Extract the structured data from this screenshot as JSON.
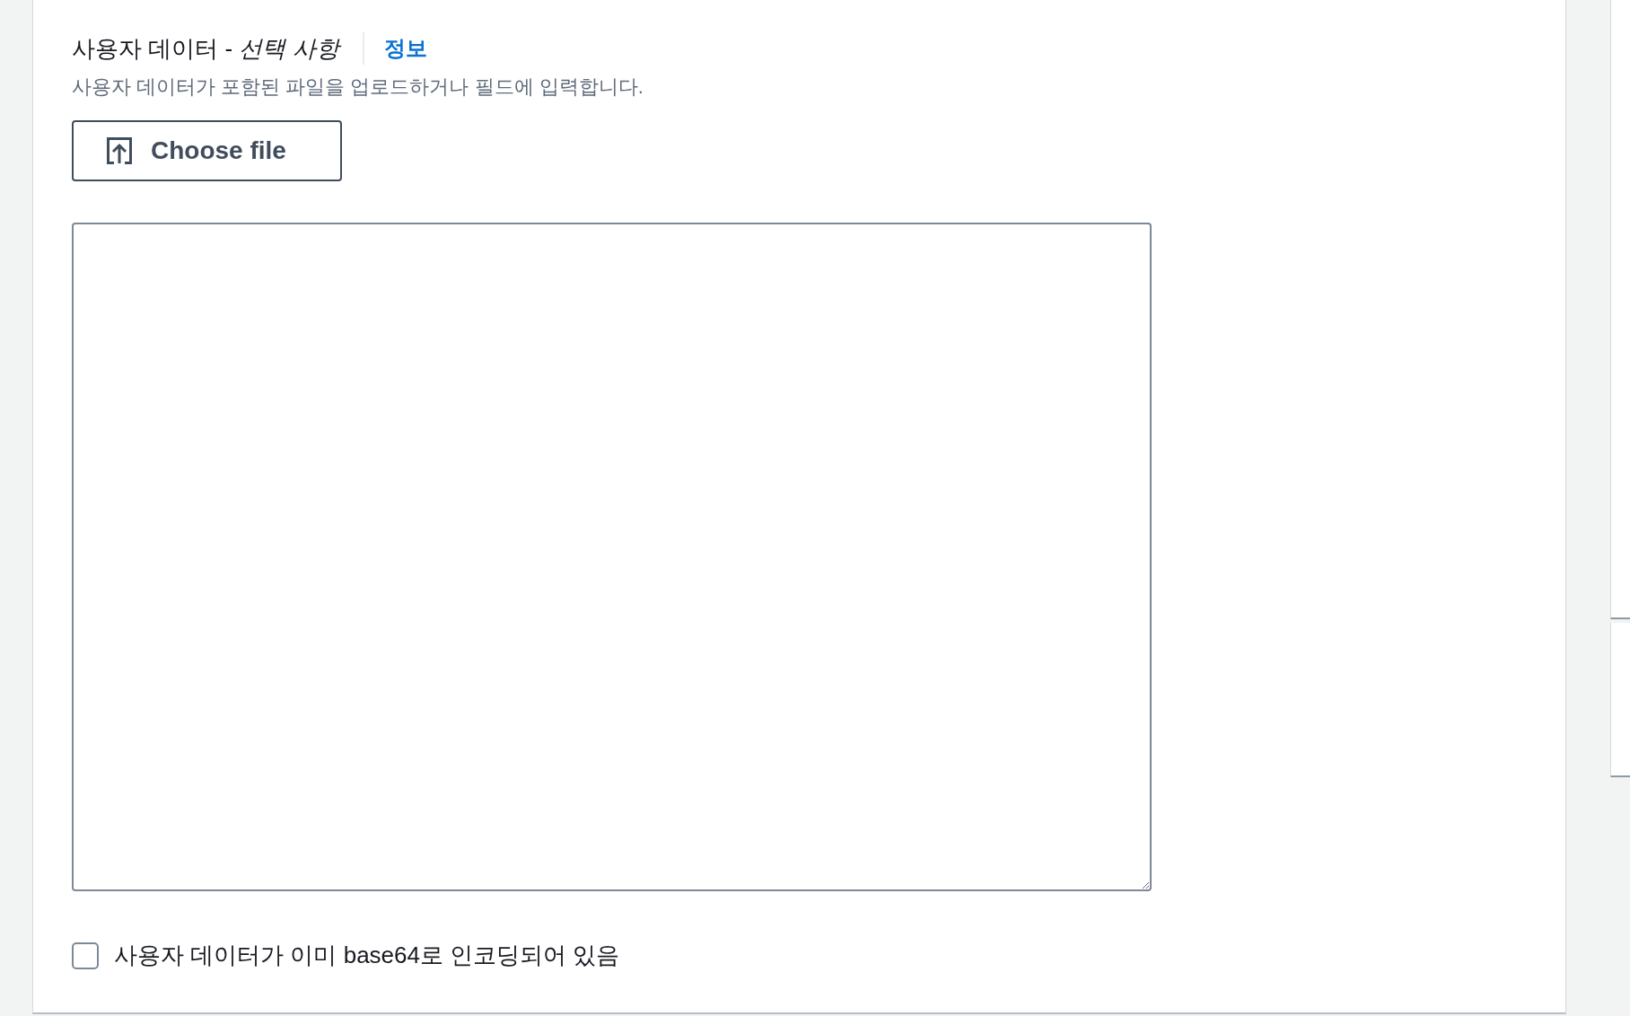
{
  "user_data": {
    "title": "사용자 데이터 - *선택 사항*",
    "info_link": "정보",
    "description": "사용자 데이터가 포함된 파일을 업로드하거나 필드에 입력합니다.",
    "choose_file_button": "Choose file",
    "encoded_checkbox": {
      "label": "사용자 데이터가 이미 base64로 인코딩되어 있음",
      "checked": false
    }
  }
}
